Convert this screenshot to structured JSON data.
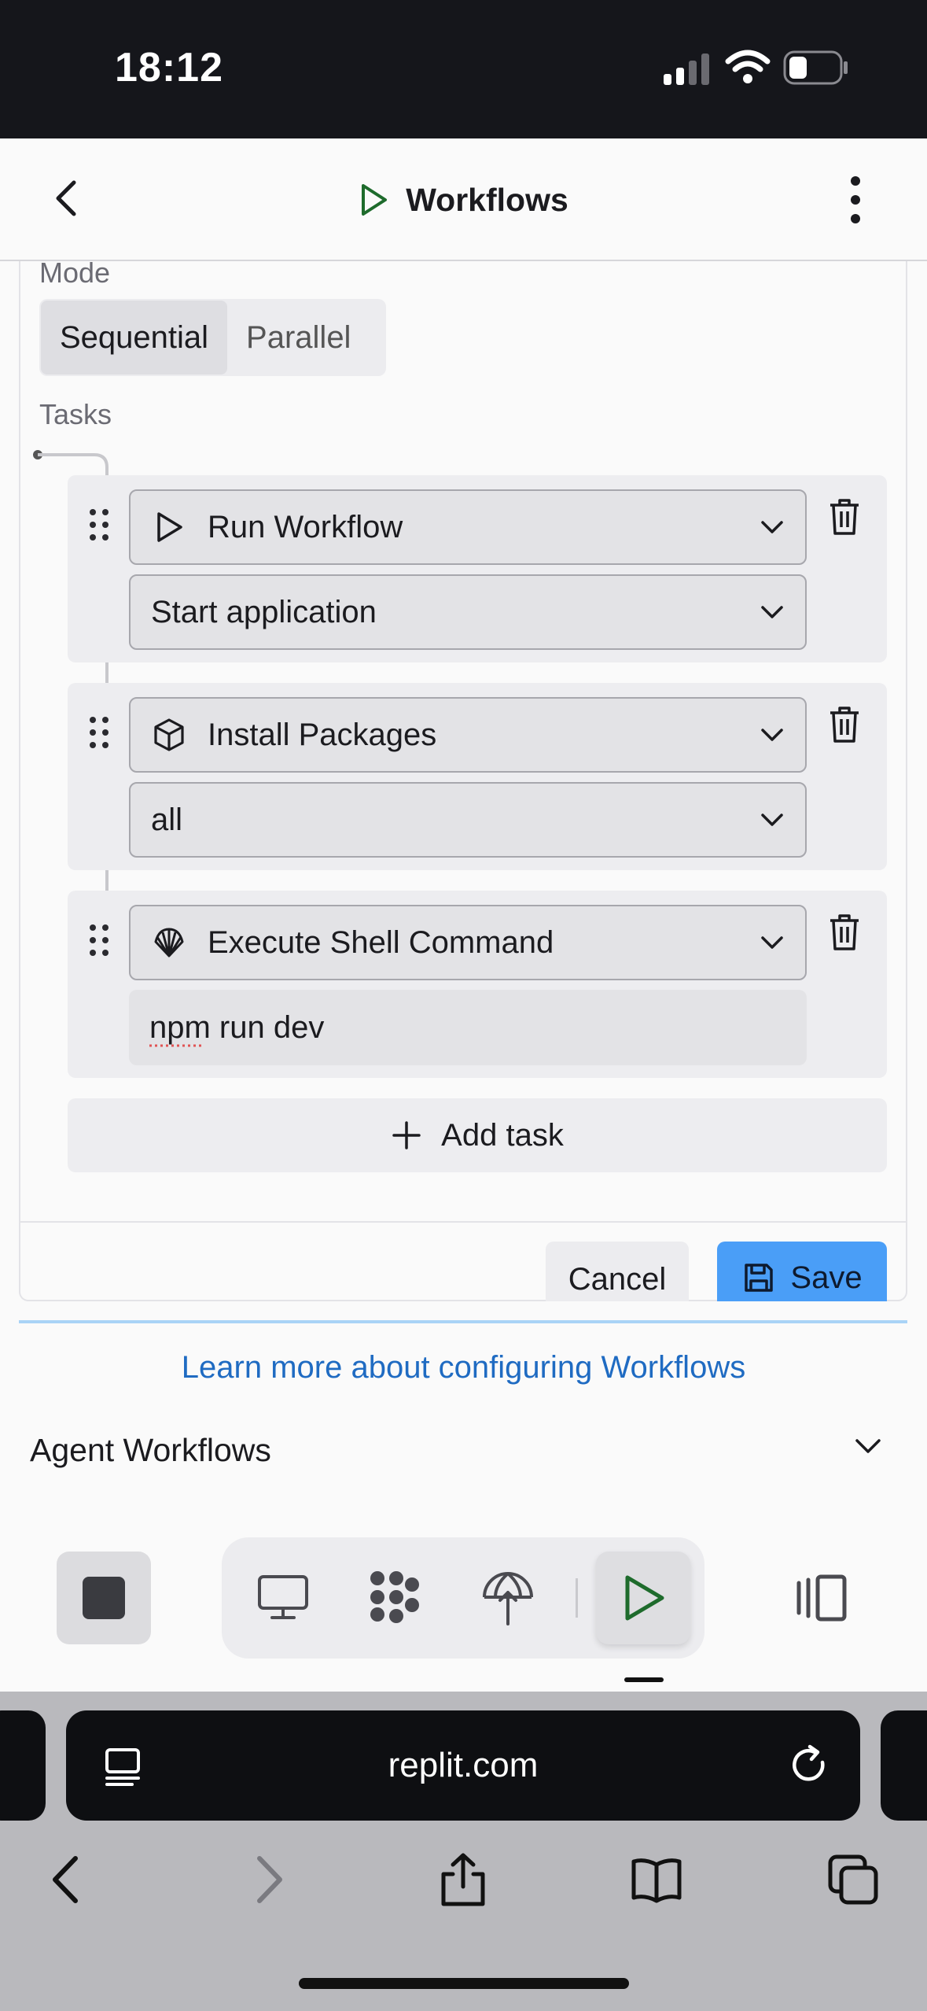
{
  "status_bar": {
    "time": "18:12"
  },
  "header": {
    "title": "Workflows",
    "back_icon": "chevron-left-icon",
    "menu_icon": "kebab-menu-icon",
    "title_icon": "play-icon"
  },
  "form": {
    "mode_label": "Mode",
    "mode_options": [
      "Sequential",
      "Parallel"
    ],
    "mode_selected": "Sequential",
    "tasks_label": "Tasks",
    "tasks": [
      {
        "type_label": "Run Workflow",
        "type_icon": "play-icon",
        "arg_kind": "select",
        "arg_value": "Start application"
      },
      {
        "type_label": "Install Packages",
        "type_icon": "package-icon",
        "arg_kind": "select",
        "arg_value": "all"
      },
      {
        "type_label": "Execute Shell Command",
        "type_icon": "shell-icon",
        "arg_kind": "input",
        "arg_value": "npm run dev"
      }
    ],
    "add_task_label": "Add task",
    "cancel_label": "Cancel",
    "save_label": "Save"
  },
  "learn_more": "Learn more about configuring Workflows",
  "agent_workflows": "Agent Workflows",
  "toolbar": {
    "stop_icon": "stop-icon",
    "tools": [
      "monitor-icon",
      "packages-grid-icon",
      "deploy-globe-icon",
      "play-icon"
    ],
    "panel_icon": "panel-switch-icon"
  },
  "browser": {
    "url": "replit.com"
  },
  "colors": {
    "accent": "#4a9ef7",
    "link": "#1f6bc2",
    "play_green": "#1e6b2c"
  }
}
